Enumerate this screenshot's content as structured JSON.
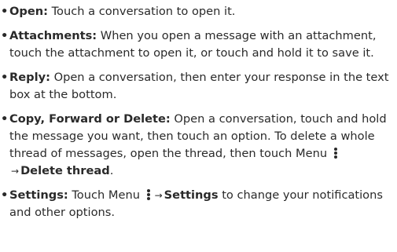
{
  "bullet": "•",
  "arrow": "→",
  "icons": {
    "menu": "vertical-dots-menu-icon"
  },
  "items": [
    {
      "term": "Open:",
      "text": " Touch a conversation to open it."
    },
    {
      "term": "Attachments:",
      "text": " When you open a message with an attachment, touch the attachment to open it, or touch and hold it to save it."
    },
    {
      "term": "Reply:",
      "text": " Open a conversation, then enter your response in the text box at the bottom."
    },
    {
      "term": "Copy, Forward or Delete:",
      "text": " Open a conversation, touch and hold the message you want, then touch an option. To delete a whole thread of messages, open the thread, then touch Menu ",
      "menu_target": "Delete thread",
      "suffix": "."
    },
    {
      "term": "Settings:",
      "text": " Touch Menu ",
      "menu_target": "Settings",
      "suffix": " to change your notifications and other options."
    }
  ]
}
